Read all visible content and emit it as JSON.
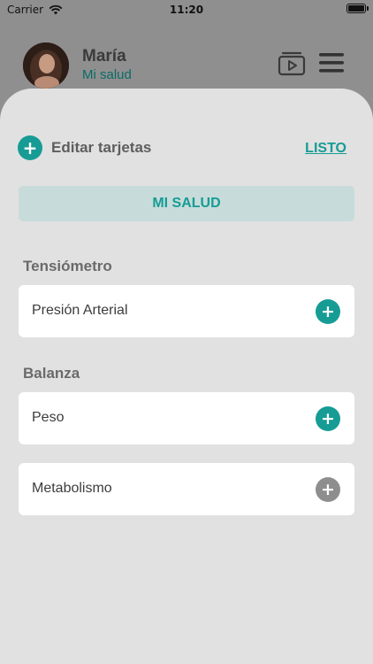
{
  "status_bar": {
    "carrier": "Carrier",
    "time": "11:20"
  },
  "header": {
    "name": "María",
    "subtitle": "Mi salud"
  },
  "edit": {
    "label": "Editar tarjetas",
    "done": "LISTO"
  },
  "tab": {
    "label": "MI SALUD"
  },
  "sections": [
    {
      "title": "Tensiómetro",
      "cards": [
        {
          "label": "Presión Arterial",
          "state": "active"
        }
      ]
    },
    {
      "title": "Balanza",
      "cards": [
        {
          "label": "Peso",
          "state": "active"
        },
        {
          "label": "Metabolismo",
          "state": "inactive"
        }
      ]
    }
  ],
  "colors": {
    "accent": "#169c95",
    "inactive": "#8e8e8e",
    "overlay": "#8f8f8f",
    "sheet": "#e1e1e1"
  },
  "icons": {
    "wifi": "wifi-icon",
    "battery": "battery-icon",
    "video": "video-library-icon",
    "menu": "hamburger-menu-icon",
    "add": "plus-circle-icon"
  }
}
